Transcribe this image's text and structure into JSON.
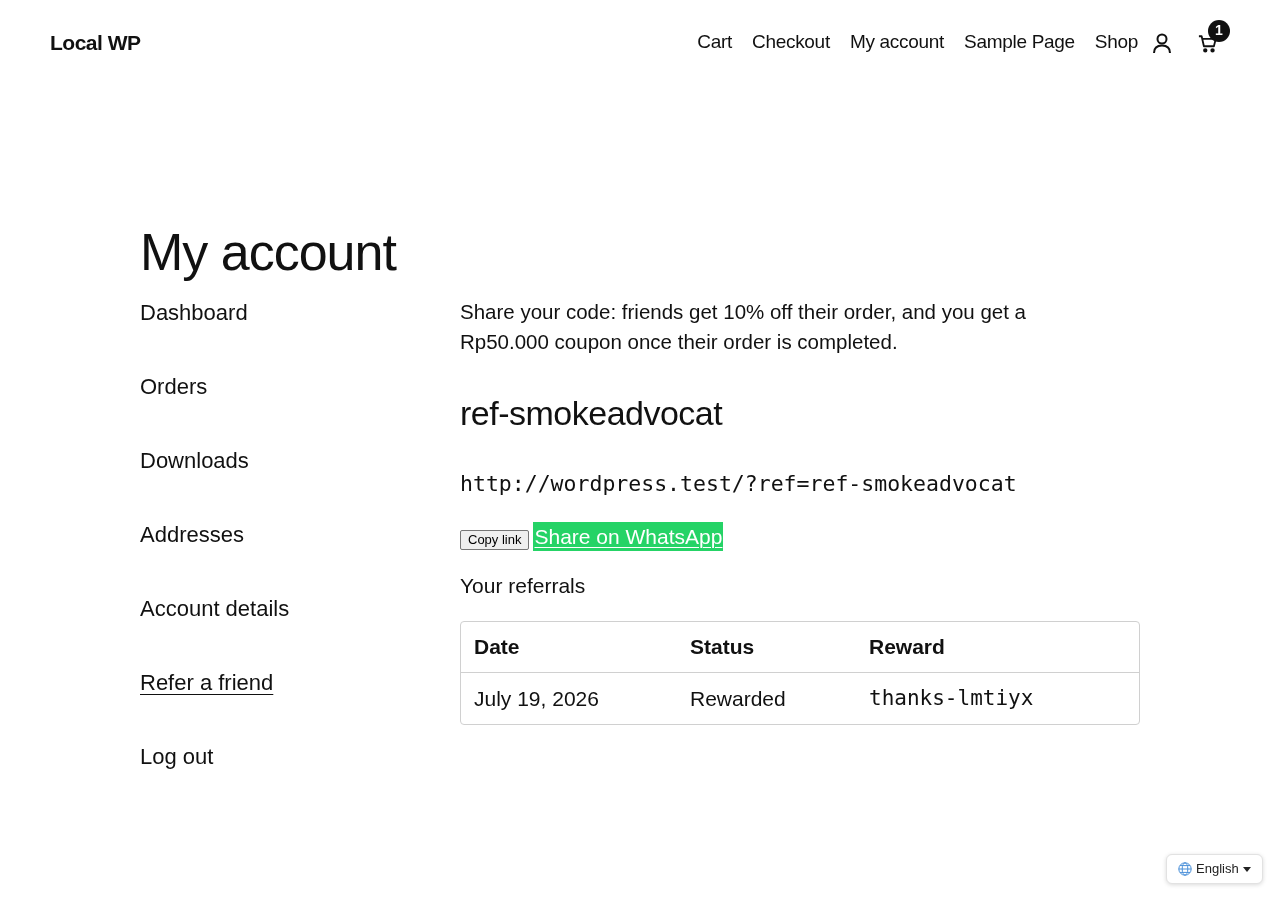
{
  "site_title": "Local WP",
  "nav": {
    "links": [
      "Cart",
      "Checkout",
      "My account",
      "Sample Page",
      "Shop"
    ],
    "cart_count": "1"
  },
  "page_title": "My account",
  "account_nav": [
    {
      "label": "Dashboard",
      "selected": false
    },
    {
      "label": "Orders",
      "selected": false
    },
    {
      "label": "Downloads",
      "selected": false
    },
    {
      "label": "Addresses",
      "selected": false
    },
    {
      "label": "Account details",
      "selected": false
    },
    {
      "label": "Refer a friend",
      "selected": true
    },
    {
      "label": "Log out",
      "selected": false
    }
  ],
  "referral": {
    "intro": "Share your code: friends get 10% off their order, and you get a Rp50.000 coupon once their order is completed.",
    "code": "ref-smokeadvocat",
    "link": "http://wordpress.test/?ref=ref-smokeadvocat",
    "copy_button": "Copy link",
    "whatsapp_button": "Share on WhatsApp",
    "referrals_heading": "Your referrals",
    "table": {
      "columns": [
        "Date",
        "Status",
        "Reward"
      ],
      "rows": [
        [
          "July 19, 2026",
          "Rewarded",
          "thanks-lmtiyx"
        ]
      ]
    }
  },
  "language_switcher": {
    "label": "English"
  }
}
